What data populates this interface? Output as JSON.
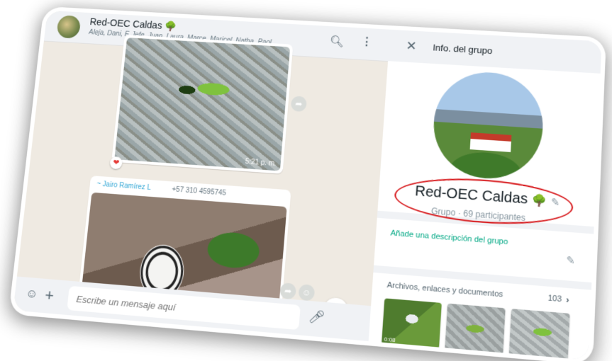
{
  "chat": {
    "title": "Red-OEC Caldas 🌳",
    "members": "Aleja, Dani, F, Jefe, Juan, Laura, Marce, Maricel, Natha, Paol...",
    "messages": [
      {
        "type": "image",
        "time": "5:21 p. m.",
        "reaction": "❤"
      },
      {
        "type": "image",
        "sender_name": "~ Jairo Ramírez L",
        "sender_phone": "+57 310 4595745"
      }
    ],
    "composer": {
      "placeholder": "Escribe un mensaje aquí"
    }
  },
  "info": {
    "header_title": "Info. del grupo",
    "group_name": "Red-OEC Caldas",
    "group_emoji": "🌳",
    "subtitle": "Grupo · 69 participantes",
    "add_description": "Añade una descripción del grupo",
    "media": {
      "label": "Archivos, enlaces y documentos",
      "count": "103",
      "thumbs": [
        {
          "badge": "0:08"
        }
      ]
    }
  },
  "icons": {
    "search": "search-icon",
    "menu": "menu-dots-icon",
    "close": "close-icon",
    "edit": "pencil-icon",
    "chevron": "chevron-right-icon",
    "forward": "forward-icon",
    "emoji": "emoji-icon",
    "attach": "plus-icon",
    "mic": "mic-icon",
    "scroll": "chevron-down-icon"
  },
  "colors": {
    "accent": "#00a884",
    "highlight": "#d7191c",
    "sender": "#35a8d6"
  }
}
